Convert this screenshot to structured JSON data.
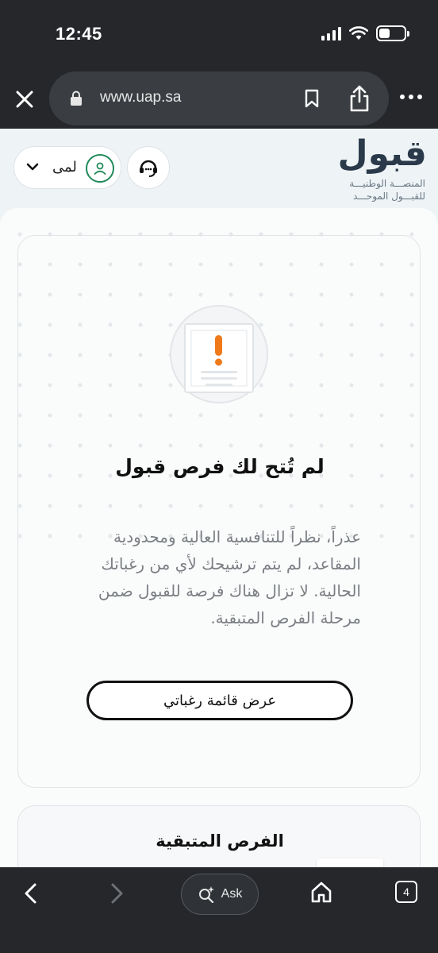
{
  "status_bar": {
    "time": "12:45"
  },
  "browser": {
    "url": "www.uap.sa",
    "ask_label": "Ask",
    "tab_count": "4"
  },
  "header": {
    "logo_word": "قبول",
    "logo_line1": "المنصـــة الوطنيـــة",
    "logo_line2": "للقبـــول الموحـــد",
    "user_name": "لمى"
  },
  "main_card": {
    "title": "لم تُتح لك فرص قبول",
    "description": "عذراً، نظراً للتنافسية العالية ومحدودية المقاعد، لم يتم ترشيحك لأي من رغباتك الحالية. لا تزال هناك فرصة للقبول ضمن مرحلة الفرص المتبقية.",
    "button_label": "عرض قائمة رغباتي"
  },
  "remaining_card": {
    "title": "الفرص المتبقية"
  },
  "colors": {
    "accent_green": "#1f8a5a",
    "alert_orange": "#f07a1a",
    "chrome_dark": "#25272b"
  }
}
